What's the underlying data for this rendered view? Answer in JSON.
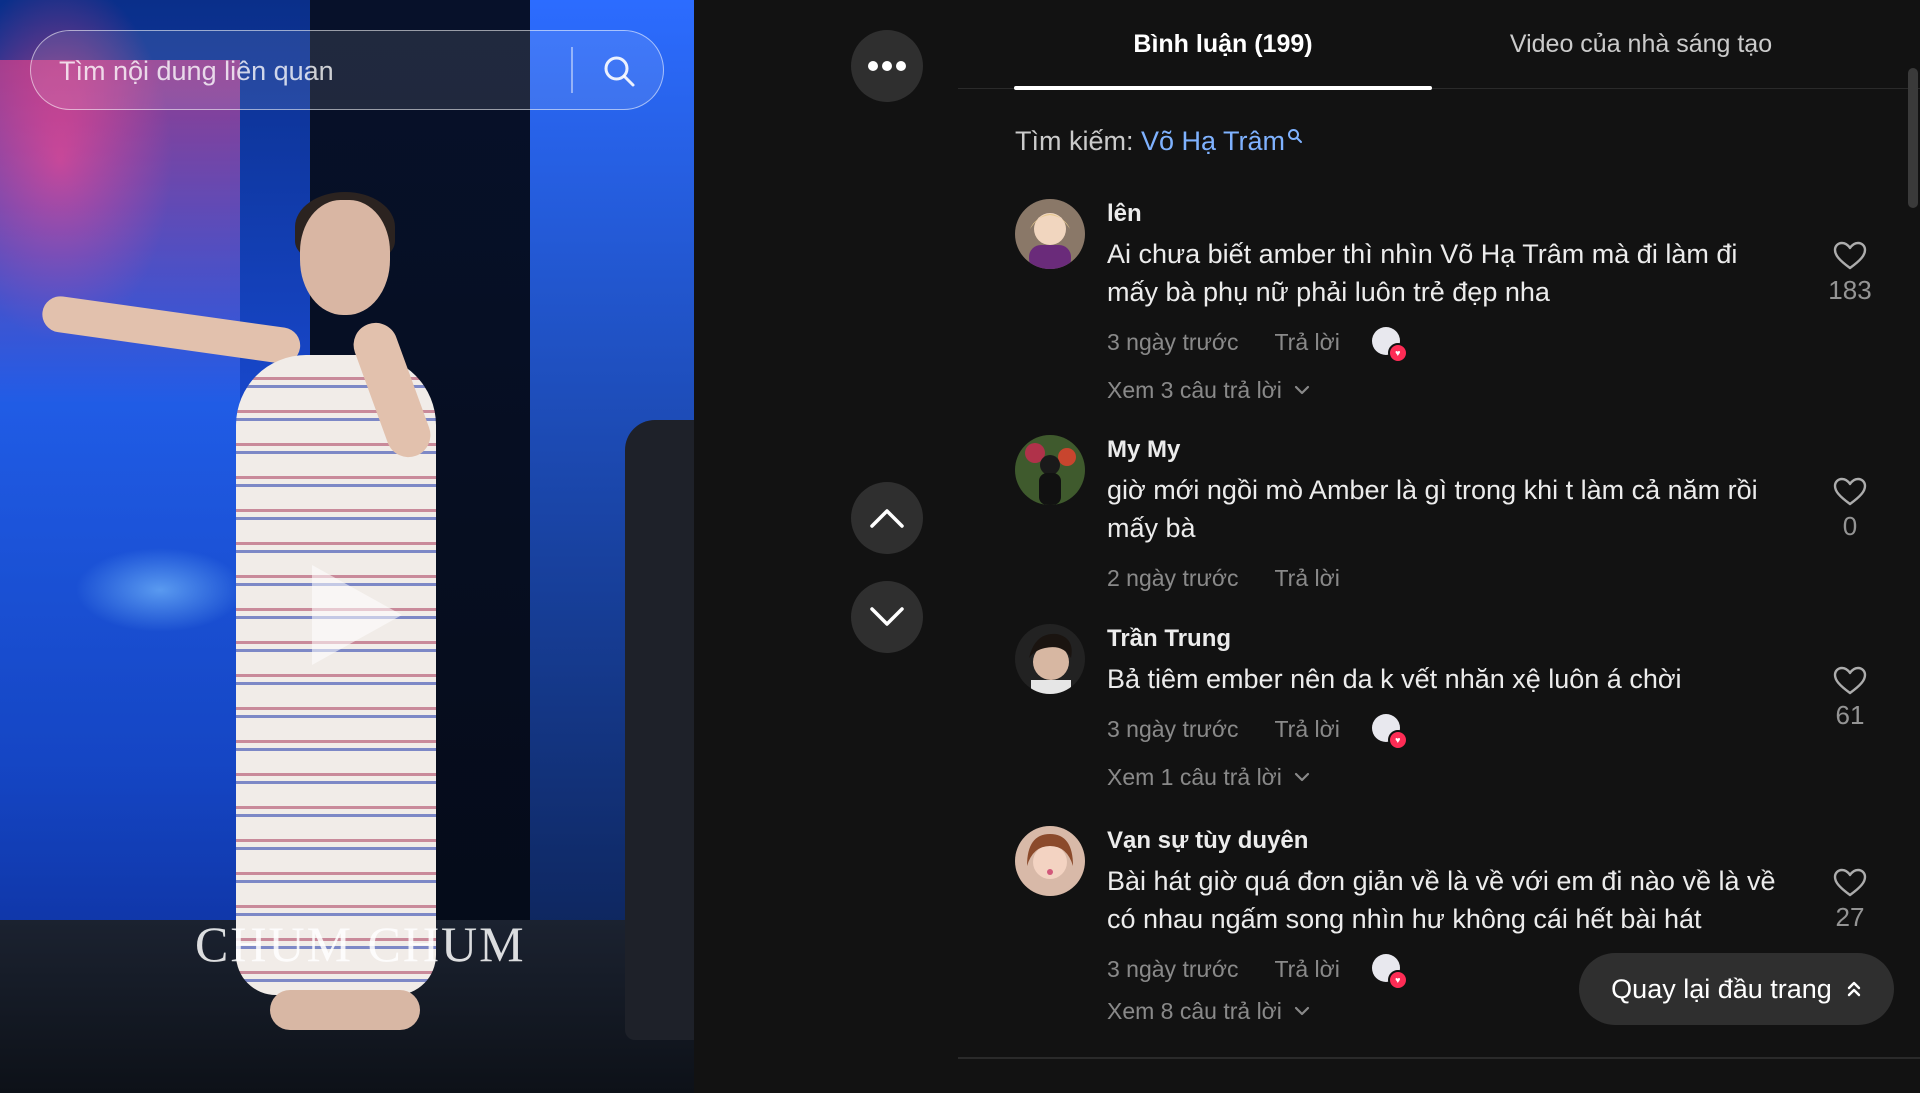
{
  "video": {
    "search_placeholder": "Tìm nội dung liên quan",
    "watermark": "CHUM CHUM"
  },
  "panel": {
    "tabs": [
      {
        "label": "Bình luận (199)",
        "active": true
      },
      {
        "label": "Video của nhà sáng tạo",
        "active": false
      }
    ],
    "search_tip": {
      "prefix": "Tìm kiếm: ",
      "keyword": "Võ Hạ Trâm"
    },
    "comments": [
      {
        "user": "lên",
        "text": "Ai chưa biết amber thì nhìn Võ Hạ Trâm mà đi làm đi mấy bà phụ nữ phải luôn trẻ đẹp nha",
        "time": "3 ngày trước",
        "reply": "Trả lời",
        "liked_by_creator": true,
        "likes": "183",
        "view_replies": "Xem 3 câu trả lời"
      },
      {
        "user": "My My",
        "text": "giờ mới ngồi mò Amber là gì trong khi t làm cả năm rồi mấy bà",
        "time": "2 ngày trước",
        "reply": "Trả lời",
        "liked_by_creator": false,
        "likes": "0",
        "view_replies": ""
      },
      {
        "user": "Trần Trung",
        "text": "Bả tiêm ember nên da k vết nhăn xệ luôn á chời",
        "time": "3 ngày trước",
        "reply": "Trả lời",
        "liked_by_creator": true,
        "likes": "61",
        "view_replies": "Xem 1 câu trả lời"
      },
      {
        "user": "Vạn sự tùy duyên",
        "text": "Bài hát giờ quá đơn giản về là về với em đi nào về là về có nhau ngấm song nhìn hư không cái hết bài hát",
        "time": "3 ngày trước",
        "reply": "Trả lời",
        "liked_by_creator": true,
        "likes": "27",
        "view_replies": "Xem 8 câu trả lời"
      }
    ],
    "back_to_top": "Quay lại đầu trang"
  },
  "icons": {
    "search": "search-icon",
    "more": "more-horizontal-icon",
    "up": "chevron-up-icon",
    "down": "chevron-down-icon",
    "heart": "heart-outline-icon",
    "back_top": "double-chevron-up-icon"
  },
  "colors": {
    "background": "#121212",
    "keyword": "#7fb2ff",
    "like_accent": "#fe2c55",
    "button_bg": "#2f2f2f"
  }
}
